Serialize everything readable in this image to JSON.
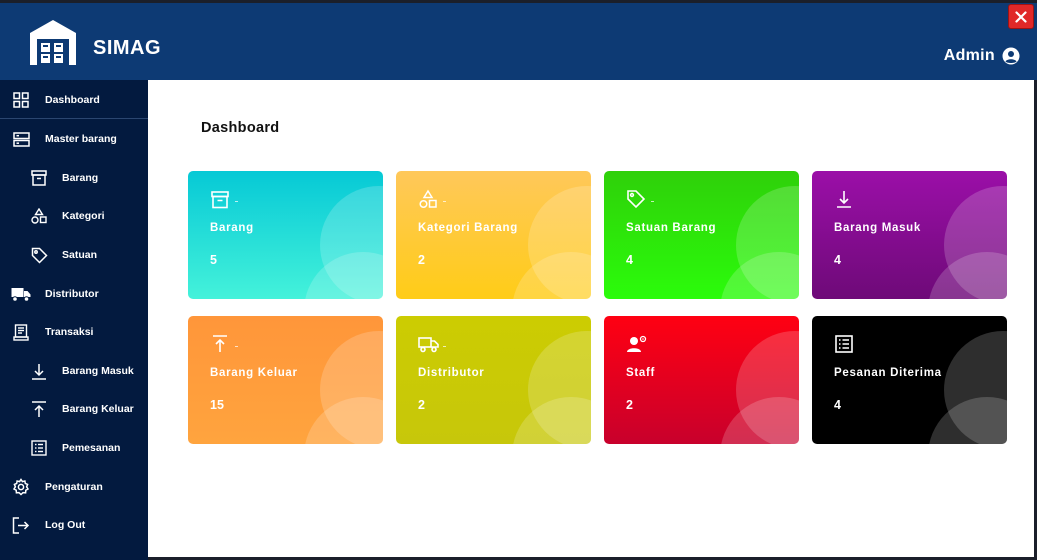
{
  "app": {
    "name": "SIMAG",
    "logo_icon": "warehouse-icon"
  },
  "header": {
    "user_label": "Admin",
    "user_icon": "user-circle-icon",
    "close_icon": "close-icon"
  },
  "sidebar": {
    "items": [
      {
        "label": "Dashboard",
        "icon": "grid-icon",
        "level": "top"
      },
      {
        "label": "Master barang",
        "icon": "server-icon",
        "level": "top"
      },
      {
        "label": "Barang",
        "icon": "archive-icon",
        "level": "sub"
      },
      {
        "label": "Kategori",
        "icon": "shapes-icon",
        "level": "sub"
      },
      {
        "label": "Satuan",
        "icon": "tag-icon",
        "level": "sub"
      },
      {
        "label": "Distributor",
        "icon": "truck-icon",
        "level": "top"
      },
      {
        "label": "Transaksi",
        "icon": "receipt-icon",
        "level": "top"
      },
      {
        "label": "Barang Masuk",
        "icon": "arrow-down-icon",
        "level": "sub"
      },
      {
        "label": "Barang Keluar",
        "icon": "arrow-up-icon",
        "level": "sub"
      },
      {
        "label": "Pemesanan",
        "icon": "list-icon",
        "level": "sub"
      },
      {
        "label": "Pengaturan",
        "icon": "gear-icon",
        "level": "top"
      },
      {
        "label": "Log Out",
        "icon": "logout-icon",
        "level": "top"
      }
    ]
  },
  "main": {
    "title": "Dashboard",
    "cards": [
      {
        "label": "Barang",
        "value": "5",
        "icon": "archive-icon",
        "colors": [
          "#06c9d6",
          "#44f2da"
        ]
      },
      {
        "label": "Kategori Barang",
        "value": "2",
        "icon": "shapes-icon",
        "colors": [
          "#ffc85a",
          "#ffcc17"
        ]
      },
      {
        "label": "Satuan Barang",
        "value": "4",
        "icon": "tag-icon",
        "colors": [
          "#2fd00a",
          "#2bfc0b"
        ]
      },
      {
        "label": "Barang Masuk",
        "value": "4",
        "icon": "arrow-down-icon",
        "colors": [
          "#9b0fa8",
          "#6e0a78"
        ]
      },
      {
        "label": "Barang Keluar",
        "value": "15",
        "icon": "arrow-up-icon",
        "colors": [
          "#ff963a",
          "#ffa43e"
        ]
      },
      {
        "label": "Distributor",
        "value": "2",
        "icon": "truck-icon",
        "colors": [
          "#cccc02",
          "#c7c70a"
        ]
      },
      {
        "label": "Staff",
        "value": "2",
        "icon": "staff-icon",
        "colors": [
          "#ff0012",
          "#c8002c"
        ]
      },
      {
        "label": "Pesanan Diterima",
        "value": "4",
        "icon": "list-icon",
        "colors": [
          "#000000",
          "#000000"
        ]
      }
    ]
  }
}
